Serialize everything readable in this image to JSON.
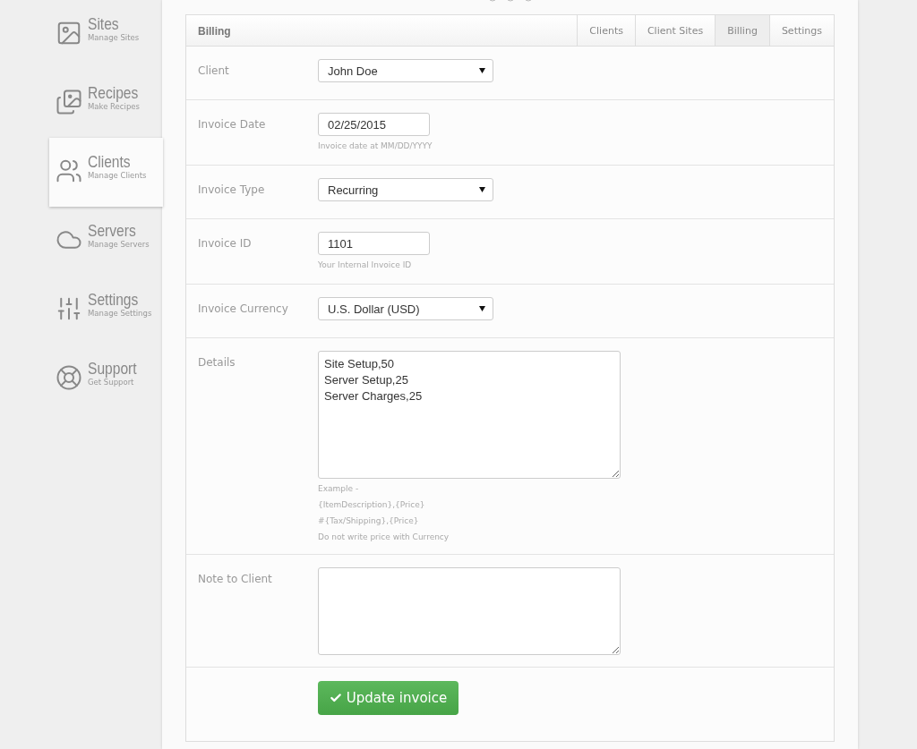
{
  "sidebar": {
    "items": [
      {
        "title": "Sites",
        "subtitle": "Manage Sites",
        "selected": false
      },
      {
        "title": "Recipes",
        "subtitle": "Make Recipes",
        "selected": false
      },
      {
        "title": "Clients",
        "subtitle": "Manage Clients",
        "selected": true
      },
      {
        "title": "Servers",
        "subtitle": "Manage Servers",
        "selected": false
      },
      {
        "title": "Settings",
        "subtitle": "Manage Settings",
        "selected": false
      },
      {
        "title": "Support",
        "subtitle": "Get Support",
        "selected": false
      }
    ]
  },
  "panel": {
    "title": "Billing",
    "tabs": [
      {
        "label": "Clients",
        "selected": false
      },
      {
        "label": "Client Sites",
        "selected": false
      },
      {
        "label": "Billing",
        "selected": true
      },
      {
        "label": "Settings",
        "selected": false
      }
    ],
    "fields": [
      {
        "kind": "select",
        "label": "Client",
        "value": "John Doe"
      },
      {
        "kind": "text",
        "label": "Invoice Date",
        "value": "02/25/2015",
        "help": [
          "Invoice date at MM/DD/YYYY"
        ]
      },
      {
        "kind": "select",
        "label": "Invoice Type",
        "value": "Recurring"
      },
      {
        "kind": "text",
        "label": "Invoice ID",
        "value": "1101",
        "help": [
          "Your Internal Invoice ID"
        ]
      },
      {
        "kind": "select",
        "label": "Invoice Currency",
        "value": "U.S. Dollar (USD)"
      },
      {
        "kind": "textarea",
        "label": "Details",
        "value": "Site Setup,50\nServer Setup,25\nServer Charges,25",
        "help": [
          "Example -",
          "{ItemDescription},{Price}",
          "#{Tax/Shipping},{Price}",
          "Do not write price with Currency"
        ]
      },
      {
        "kind": "textarea",
        "label": "Note to Client"
      }
    ],
    "submit": "Update invoice"
  }
}
